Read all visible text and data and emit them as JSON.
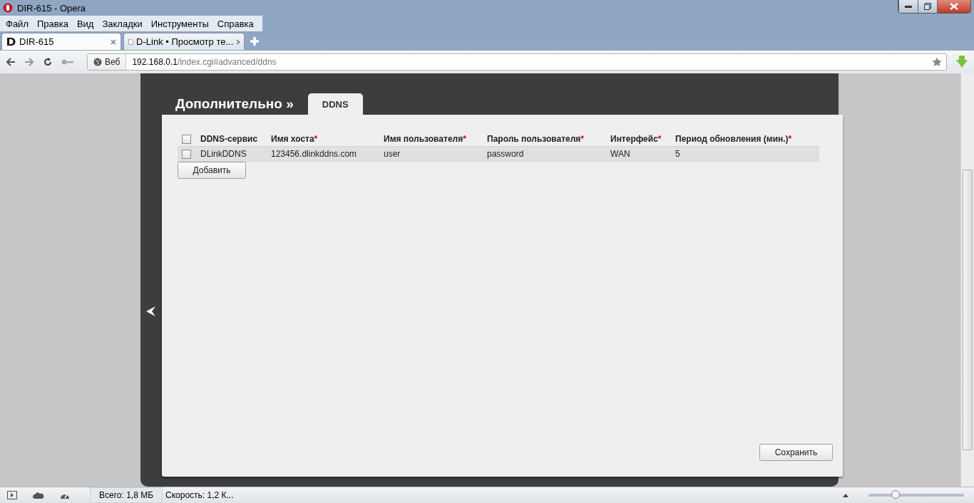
{
  "window": {
    "title": "DIR-615 - Opera"
  },
  "menu": [
    "Файл",
    "Правка",
    "Вид",
    "Закладки",
    "Инструменты",
    "Справка"
  ],
  "tabs": [
    {
      "label": "DIR-615",
      "selected": true,
      "kind": "dlink"
    },
    {
      "label": "D-Link • Просмотр те...",
      "selected": false,
      "kind": "page"
    }
  ],
  "address": {
    "badge": "Веб",
    "host": "192.168.0.1",
    "path": "/index.cgi#advanced/ddns"
  },
  "page": {
    "heading": "Дополнительно »",
    "tab": "DDNS",
    "columns": [
      {
        "label": "DDNS-сервис"
      },
      {
        "label": "Имя хоста",
        "mark": "*"
      },
      {
        "label": "Имя пользователя",
        "mark": "*"
      },
      {
        "label": "Пароль пользователя",
        "mark": "*"
      },
      {
        "label": "Интерфейс",
        "mark": "*"
      },
      {
        "label": "Период обновления (мин.)",
        "mark": "*"
      }
    ],
    "rows": [
      {
        "checked": false,
        "cells": [
          "DLinkDDNS",
          "123456.dlinkddns.com",
          "user",
          "password",
          "WAN",
          "5"
        ]
      }
    ],
    "header_checked": false,
    "add_button": "Добавить",
    "save_button": "Сохранить"
  },
  "status_bar": {
    "total": "Всего:  1,8 МБ",
    "speed": "Скорость:  1,2 К...",
    "zoom": {
      "level": 0.28
    }
  }
}
